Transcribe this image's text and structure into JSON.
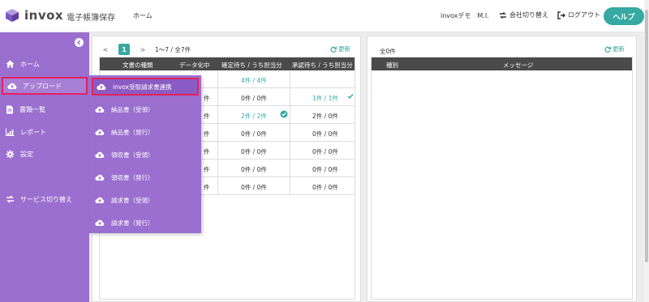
{
  "header": {
    "brand": "invox",
    "brand_sub": "電子帳簿保存",
    "nav_home": "ホーム",
    "user": "invoxデモ　M.I.",
    "switch_company": "会社切り替え",
    "logout": "ログアウト",
    "help": "ヘルプ"
  },
  "colors": {
    "accent": "#35a9a2",
    "sidebar": "#9b6fd0",
    "highlight": "#e0245e",
    "table_header": "#4a4a4a"
  },
  "sidebar": {
    "items": [
      {
        "label": "ホーム",
        "icon": "home-icon"
      },
      {
        "label": "アップロード",
        "icon": "cloud-upload-icon"
      },
      {
        "label": "書類一覧",
        "icon": "document-icon"
      },
      {
        "label": "レポート",
        "icon": "chart-icon"
      },
      {
        "label": "設定",
        "icon": "gear-icon"
      },
      {
        "label": "サービス切り替え",
        "icon": "swap-icon"
      }
    ]
  },
  "upload_menu": {
    "items": [
      {
        "label": "invox受取請求書連携"
      },
      {
        "label": "納品書（受領）"
      },
      {
        "label": "納品書（発行）"
      },
      {
        "label": "領収書（受領）"
      },
      {
        "label": "領収書（発行）"
      },
      {
        "label": "請求書（受領）"
      },
      {
        "label": "請求書（発行）"
      }
    ]
  },
  "left_panel": {
    "pager_prev": "<",
    "pager_current": "1",
    "pager_next": ">",
    "pager_info": "1〜7 / 全7件",
    "refresh": "更新",
    "columns": [
      "文書の種類",
      "データ化中",
      "確定待ち / うち担当分",
      "承認待ち / うち担当分"
    ],
    "rows": [
      {
        "data_partial": "",
        "confirm": "4件 / 4件",
        "approve": ""
      },
      {
        "data_partial": "件",
        "confirm": "0件 / 0件",
        "approve": "1件 / 1件"
      },
      {
        "data_partial": "件",
        "confirm": "2件 / 2件",
        "approve": "2件 / 0件"
      },
      {
        "data_partial": "件",
        "confirm": "0件 / 0件",
        "approve": "0件 / 0件"
      },
      {
        "data_partial": "件",
        "confirm": "0件 / 0件",
        "approve": "0件 / 0件"
      },
      {
        "data_partial": "件",
        "confirm": "0件 / 0件",
        "approve": "0件 / 0件"
      },
      {
        "data_partial": "件",
        "confirm": "0件 / 0件",
        "approve": "0件 / 0件"
      }
    ]
  },
  "right_panel": {
    "count": "全0件",
    "refresh": "更新",
    "columns": [
      "種別",
      "メッセージ"
    ]
  }
}
